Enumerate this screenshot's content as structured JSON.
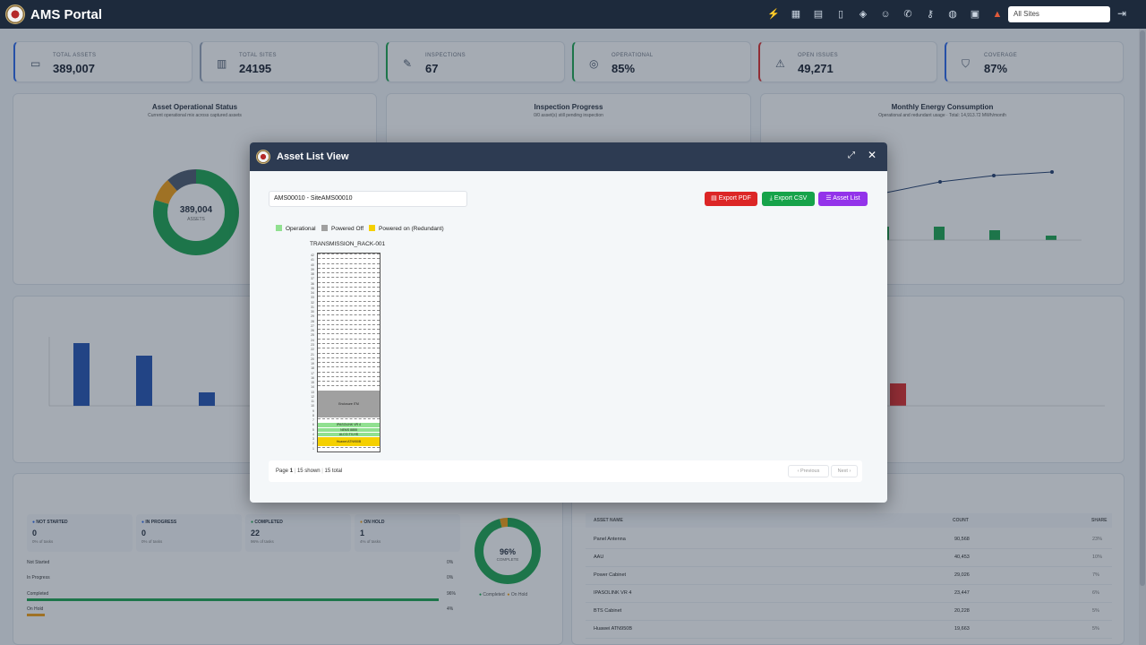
{
  "app": {
    "title": "AMS Portal",
    "site_select": "All Sites"
  },
  "topbar": {
    "icons": [
      "bolt-icon",
      "table-icon",
      "clipboard-icon",
      "map-icon",
      "box-icon",
      "users-icon",
      "phone-icon",
      "key-icon",
      "globe-icon",
      "calendar-icon",
      "chart-icon"
    ]
  },
  "stats": [
    {
      "label": "TOTAL ASSETS",
      "value": "389,007",
      "icon": "server-icon",
      "accent": "#2563eb"
    },
    {
      "label": "TOTAL SITES",
      "value": "24195",
      "icon": "building-icon",
      "accent": "#94a3b8"
    },
    {
      "label": "INSPECTIONS",
      "value": "67",
      "icon": "wrench-icon",
      "accent": "#16a34a"
    },
    {
      "label": "OPERATIONAL",
      "value": "85%",
      "icon": "check-circle-icon",
      "accent": "#16a34a"
    },
    {
      "label": "OPEN ISSUES",
      "value": "49,271",
      "icon": "warning-icon",
      "accent": "#dc2626"
    },
    {
      "label": "COVERAGE",
      "value": "87%",
      "icon": "shield-icon",
      "accent": "#2563eb"
    }
  ],
  "cards": {
    "asset_status": {
      "title": "Asset Operational Status",
      "subtitle": "Current operational mix across captured assets",
      "center_value": "389,004",
      "center_label": "ASSETS"
    },
    "inspection": {
      "title": "Inspection Progress",
      "subtitle": "0/0 asset(s) still pending inspection"
    },
    "energy": {
      "title": "Monthly Energy Consumption",
      "subtitle": "Operational and redundant usage · Total: 14,913.72 MWh/month"
    },
    "tasks": {
      "stats": [
        {
          "label": "NOT STARTED",
          "value": "0",
          "sub": "0% of tasks",
          "color": "#2563eb"
        },
        {
          "label": "IN PROGRESS",
          "value": "0",
          "sub": "0% of tasks",
          "color": "#2563eb"
        },
        {
          "label": "COMPLETED",
          "value": "22",
          "sub": "96% of tasks",
          "color": "#16a34a"
        },
        {
          "label": "ON HOLD",
          "value": "1",
          "sub": "4% of tasks",
          "color": "#f59e0b"
        }
      ],
      "bars": [
        {
          "label": "Not Started",
          "pct": "0%"
        },
        {
          "label": "In Progress",
          "pct": "0%"
        },
        {
          "label": "Completed",
          "pct": "96%"
        },
        {
          "label": "On Hold",
          "pct": "4%"
        }
      ],
      "donut_value": "96%",
      "donut_label": "COMPLETE",
      "legend": [
        "Completed",
        "On Hold"
      ]
    },
    "asset_table": {
      "headers": [
        "ASSET NAME",
        "COUNT",
        "SHARE"
      ],
      "rows": [
        [
          "Panel Antenna",
          "90,568",
          "23%"
        ],
        [
          "AAU",
          "40,453",
          "10%"
        ],
        [
          "Power Cabinet",
          "29,026",
          "7%"
        ],
        [
          "IPASOLINK VR 4",
          "23,447",
          "6%"
        ],
        [
          "BTS Cabinet",
          "20,228",
          "5%"
        ],
        [
          "Huawei ATN950B",
          "19,663",
          "5%"
        ]
      ]
    }
  },
  "modal": {
    "title": "Asset List View",
    "site_value": "AMS00010 - SiteAMS00010",
    "buttons": {
      "export_pdf": "Export PDF",
      "export_csv": "Export CSV",
      "asset_list": "Asset List"
    },
    "legend": [
      {
        "label": "Operational",
        "color": "#90e090"
      },
      {
        "label": "Powered Off",
        "color": "#a0a0a0"
      },
      {
        "label": "Powered on (Redundant)",
        "color": "#f5d000"
      }
    ],
    "rack": {
      "title": "TRANSMISSION_RACK-001",
      "units": 42,
      "slots": [
        {
          "label": "Enclosure ITM",
          "status": "powered_off",
          "start": 8,
          "end": 13
        },
        {
          "label": "IPASOLINK VR 4",
          "status": "operational",
          "start": 6,
          "end": 6
        },
        {
          "label": "NEMS 8855",
          "status": "operational",
          "start": 5,
          "end": 5
        },
        {
          "label": "ALCO-TX-HS",
          "status": "operational",
          "start": 4,
          "end": 4
        },
        {
          "label": "Huawei ATN950B",
          "status": "redundant",
          "start": 2,
          "end": 3
        }
      ]
    },
    "pagination": {
      "page_label": "Page",
      "page": "1",
      "shown": "15 shown",
      "total": "15 total",
      "prev": "‹ Previous",
      "next": "Next ›"
    }
  }
}
